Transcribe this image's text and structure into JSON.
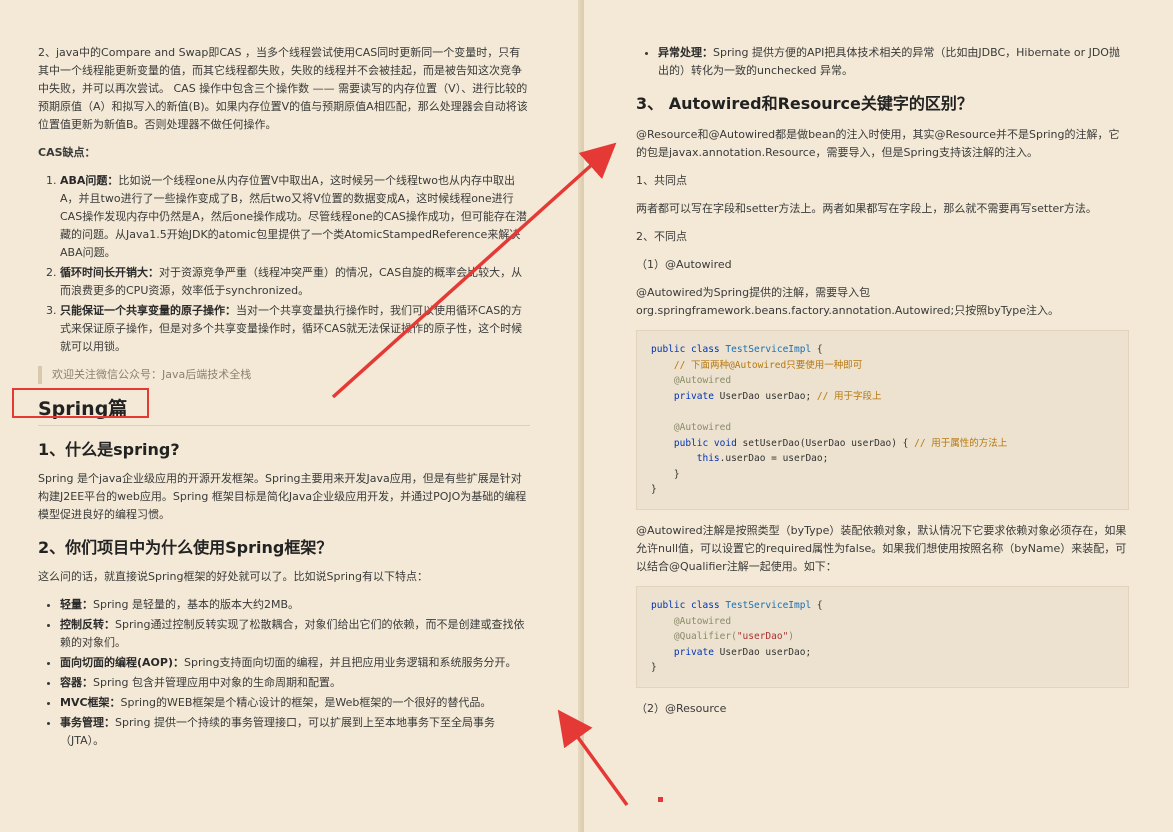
{
  "left": {
    "cas_intro": "2、java中的Compare and Swap即CAS ，当多个线程尝试使用CAS同时更新同一个变量时，只有其中一个线程能更新变量的值，而其它线程都失败，失败的线程并不会被挂起，而是被告知这次竞争中失败，并可以再次尝试。  CAS 操作中包含三个操作数 —— 需要读写的内存位置（V）、进行比较的预期原值（A）和拟写入的新值(B)。如果内存位置V的值与预期原值A相匹配，那么处理器会自动将该位置值更新为新值B。否则处理器不做任何操作。",
    "cas_defects_label": "CAS缺点：",
    "defects": [
      {
        "title": "ABA问题：",
        "text": "比如说一个线程one从内存位置V中取出A，这时候另一个线程two也从内存中取出A，并且two进行了一些操作变成了B，然后two又将V位置的数据变成A，这时候线程one进行CAS操作发现内存中仍然是A，然后one操作成功。尽管线程one的CAS操作成功，但可能存在潜藏的问题。从Java1.5开始JDK的atomic包里提供了一个类AtomicStampedReference来解决ABA问题。"
      },
      {
        "title": "循环时间长开销大：",
        "text": "对于资源竞争严重（线程冲突严重）的情况，CAS自旋的概率会比较大，从而浪费更多的CPU资源，效率低于synchronized。"
      },
      {
        "title": "只能保证一个共享变量的原子操作：",
        "text": "当对一个共享变量执行操作时，我们可以使用循环CAS的方式来保证原子操作，但是对多个共享变量操作时，循环CAS就无法保证操作的原子性，这个时候就可以用锁。"
      }
    ],
    "quote": "欢迎关注微信公众号：Java后端技术全栈",
    "spring_heading": "Spring篇",
    "q1_heading": "1、什么是spring?",
    "q1_text": "Spring 是个java企业级应用的开源开发框架。Spring主要用来开发Java应用，但是有些扩展是针对构建J2EE平台的web应用。Spring 框架目标是简化Java企业级应用开发，并通过POJO为基础的编程模型促进良好的编程习惯。",
    "q2_heading": "2、你们项目中为什么使用Spring框架？",
    "q2_intro": "这么问的话，就直接说Spring框架的好处就可以了。比如说Spring有以下特点：",
    "features": [
      {
        "title": "轻量：",
        "text": "Spring 是轻量的，基本的版本大约2MB。"
      },
      {
        "title": "控制反转：",
        "text": "Spring通过控制反转实现了松散耦合，对象们给出它们的依赖，而不是创建或查找依赖的对象们。"
      },
      {
        "title": "面向切面的编程(AOP)：",
        "text": "Spring支持面向切面的编程，并且把应用业务逻辑和系统服务分开。"
      },
      {
        "title": "容器：",
        "text": "Spring 包含并管理应用中对象的生命周期和配置。"
      },
      {
        "title": "MVC框架：",
        "text": "Spring的WEB框架是个精心设计的框架，是Web框架的一个很好的替代品。"
      },
      {
        "title": "事务管理：",
        "text": "Spring 提供一个持续的事务管理接口，可以扩展到上至本地事务下至全局事务（JTA）。"
      }
    ]
  },
  "right": {
    "exception_title": "异常处理：",
    "exception_text": "Spring 提供方便的API把具体技术相关的异常（比如由JDBC，Hibernate or JDO抛出的）转化为一致的unchecked 异常。",
    "q3_heading": "3、 Autowired和Resource关键字的区别？",
    "q3_intro": "@Resource和@Autowired都是做bean的注入时使用，其实@Resource并不是Spring的注解，它的包是javax.annotation.Resource，需要导入，但是Spring支持该注解的注入。",
    "common_label": "1、共同点",
    "common_text": "两者都可以写在字段和setter方法上。两者如果都写在字段上，那么就不需要再写setter方法。",
    "diff_label": "2、不同点",
    "autowired_label": "（1）@Autowired",
    "autowired_text": "@Autowired为Spring提供的注解，需要导入包org.springframework.beans.factory.annotation.Autowired;只按照byType注入。",
    "code1": {
      "kw_public_class": "public class",
      "class_name": "TestServiceImpl",
      "brace_open": " {",
      "comment1": "// 下面两种@Autowired只要使用一种即可",
      "annotation": "@Autowired",
      "kw_private": "private",
      "field_decl": " UserDao userDao; ",
      "comment2": "// 用于字段上",
      "kw_public_void": "public void",
      "method_sig": " setUserDao(UserDao userDao) { ",
      "comment3": "// 用于属性的方法上",
      "kw_this": "this",
      "assign": ".userDao = userDao;",
      "inner_close": "}",
      "outer_close": "}"
    },
    "autowired_note": "@Autowired注解是按照类型（byType）装配依赖对象，默认情况下它要求依赖对象必须存在，如果允许null值，可以设置它的required属性为false。如果我们想使用按照名称（byName）来装配，可以结合@Qualifier注解一起使用。如下：",
    "code2": {
      "kw_public_class": "public class",
      "class_name": "TestServiceImpl",
      "brace_open": " {",
      "annotation": "@Autowired",
      "qualifier": "@Qualifier(",
      "qualifier_arg": "\"userDao\"",
      "qualifier_close": ")",
      "kw_private": "private",
      "field_decl": " UserDao userDao;",
      "outer_close": "}"
    },
    "resource_label": "（2）@Resource"
  },
  "colors": {
    "annotation_red": "#e53935",
    "page_bg": "#f3e9d6",
    "code_bg": "#ece2cf"
  }
}
